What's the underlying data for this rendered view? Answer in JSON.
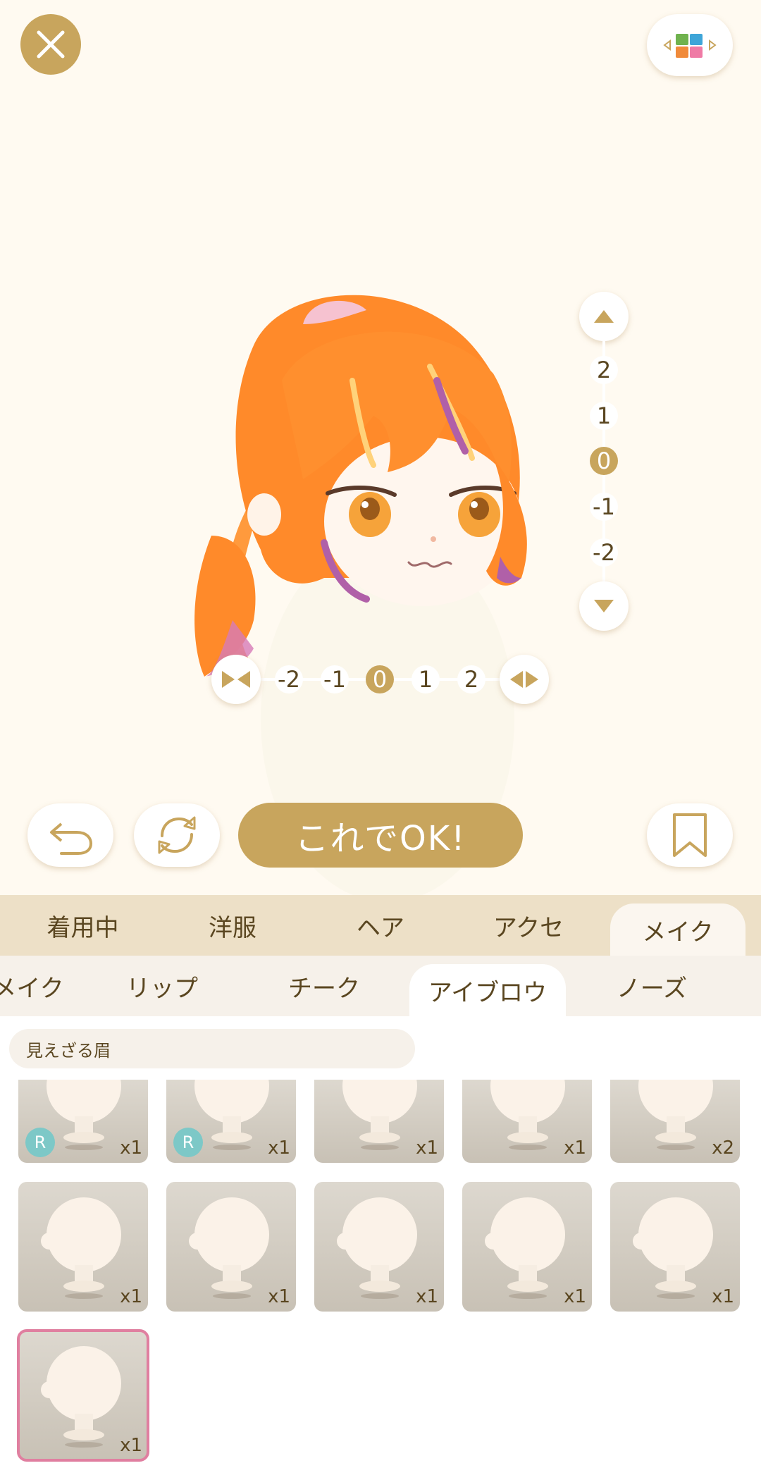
{
  "top_bar": {
    "close_icon": "close-icon",
    "switch_icon": "color-palette-switch-icon"
  },
  "vertical_position": {
    "up_icon": "triangle-up-icon",
    "down_icon": "triangle-down-icon",
    "levels": [
      "2",
      "1",
      "0",
      "-1",
      "-2"
    ],
    "selected": "0"
  },
  "horizontal_width": {
    "narrow_icon": "narrow-icon",
    "wide_icon": "widen-icon",
    "levels": [
      "-2",
      "-1",
      "0",
      "1",
      "2"
    ],
    "selected": "0"
  },
  "controls": {
    "undo_icon": "undo-icon",
    "refresh_icon": "refresh-icon",
    "ok_label": "これでOK!",
    "bookmark_icon": "bookmark-icon"
  },
  "category_tabs": [
    {
      "label": "着用中",
      "active": false
    },
    {
      "label": "洋服",
      "active": false
    },
    {
      "label": "ヘア",
      "active": false
    },
    {
      "label": "アクセ",
      "active": false
    },
    {
      "label": "メイク",
      "active": true
    }
  ],
  "sub_tabs": [
    {
      "label": "メイク",
      "active": false
    },
    {
      "label": "リップ",
      "active": false
    },
    {
      "label": "チーク",
      "active": false
    },
    {
      "label": "アイブロウ",
      "active": true
    },
    {
      "label": "ノーズ",
      "active": false
    }
  ],
  "item_name": "見えざる眉",
  "items_row1": [
    {
      "qty": "x1",
      "badge": "R"
    },
    {
      "qty": "x1",
      "badge": "R"
    },
    {
      "qty": "x1",
      "badge": ""
    },
    {
      "qty": "x1",
      "badge": ""
    },
    {
      "qty": "x2",
      "badge": ""
    }
  ],
  "items_row2": [
    {
      "qty": "x1"
    },
    {
      "qty": "x1"
    },
    {
      "qty": "x1"
    },
    {
      "qty": "x1"
    },
    {
      "qty": "x1"
    }
  ],
  "items_row3": [
    {
      "qty": "x1",
      "selected": true
    }
  ],
  "colors": {
    "accent": "#c8a55d",
    "background": "#fffaf1",
    "selected_border": "#e07fa0",
    "badge": "#7dc8c7"
  }
}
